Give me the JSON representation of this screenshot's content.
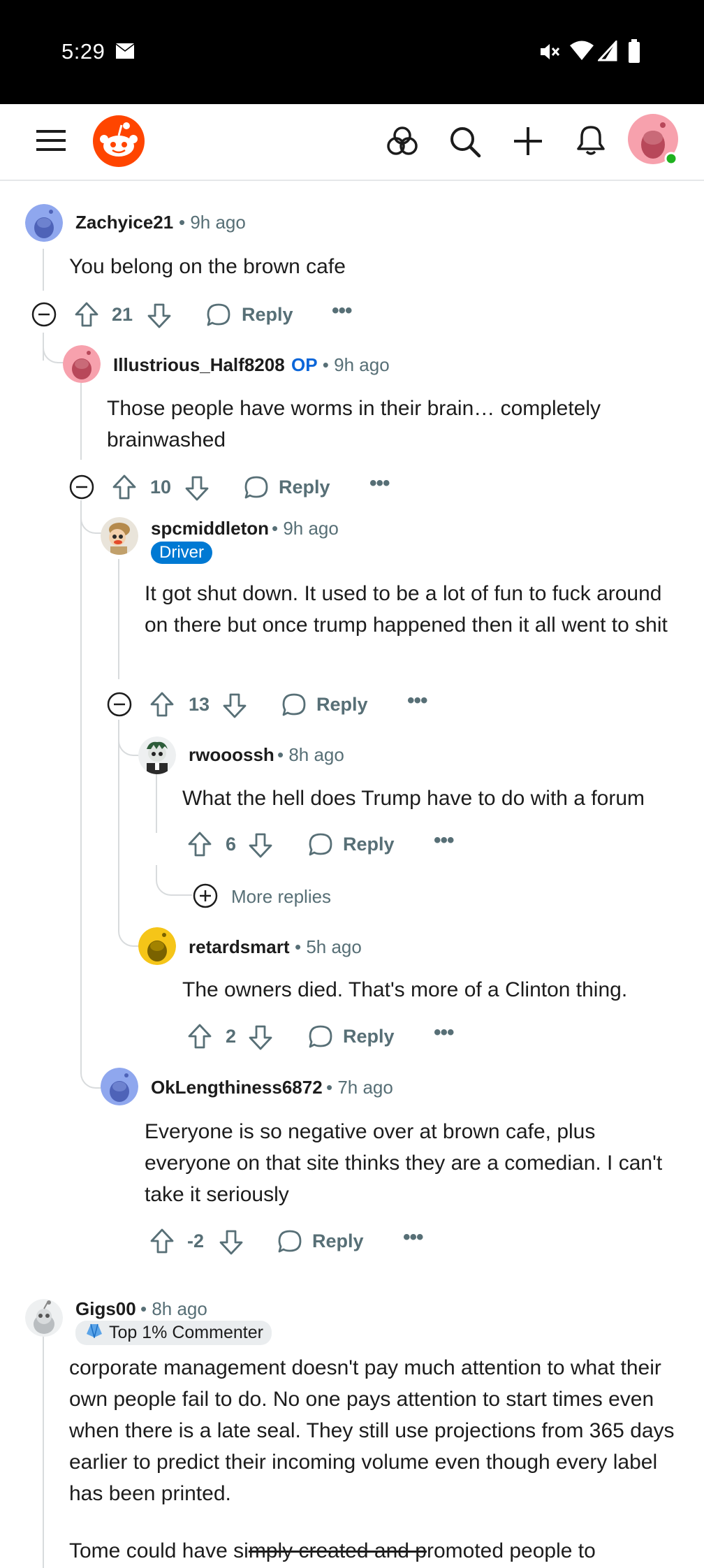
{
  "status_bar": {
    "time": "5:29"
  },
  "app_bar": {
    "menu_icon": "hamburger-icon",
    "logo_icon": "reddit-logo-icon",
    "actions": [
      "communities-icon",
      "search-icon",
      "create-plus-icon",
      "bell-icon"
    ],
    "avatar_icon": "user-avatar-icon"
  },
  "comments": [
    {
      "user": "Zachyice21",
      "time": "9h ago",
      "text": "You belong on the brown cafe",
      "votes": "21",
      "reply": "Reply"
    },
    {
      "user": "Illustrious_Half8208",
      "op": "OP",
      "time": "9h ago",
      "text": "Those people have worms in their brain… completely brainwashed",
      "votes": "10",
      "reply": "Reply"
    },
    {
      "user": "spcmiddleton",
      "time": "9h ago",
      "flair": "Driver",
      "text": "It got shut down. It used to be a lot of fun to fuck around on there but once trump happened then it all went to shit",
      "votes": "13",
      "reply": "Reply"
    },
    {
      "user": "rwooossh",
      "time": "8h ago",
      "text": "What the hell does Trump have to do with a forum",
      "votes": "6",
      "reply": "Reply",
      "more_replies": "More replies"
    },
    {
      "user": "retardsmart",
      "time": "5h ago",
      "text": "The owners died. That's more of a Clinton thing.",
      "votes": "2",
      "reply": "Reply"
    },
    {
      "user": "OkLengthiness6872",
      "time": "7h ago",
      "text": "Everyone is so negative over at brown cafe, plus everyone on that site thinks they are a comedian. I can't take it seriously",
      "votes": "-2",
      "reply": "Reply"
    },
    {
      "user": "Gigs00",
      "time": "8h ago",
      "flair": "Top 1% Commenter",
      "text": "corporate management doesn't pay much attention to what their own people fail to do. No one pays attention to start times even when there is a late seal. They still use projections from 365 days earlier to predict their incoming volume even though every label has been printed.",
      "text2_pre": "Tome could have si",
      "text2_strike": "mply created and p",
      "text2_post": "romoted people to"
    }
  ],
  "colors": {
    "accent": "#ff4500",
    "op_blue": "#0a66d9",
    "flair_blue": "#0079d3",
    "meta_gray": "#576f76",
    "thread_line": "#d8dbdd"
  }
}
